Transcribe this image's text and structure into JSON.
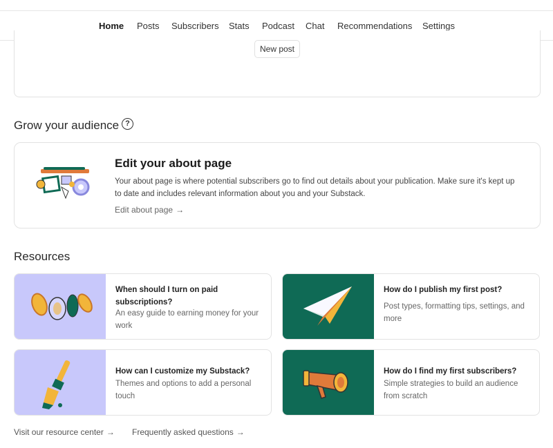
{
  "nav": {
    "tabs": [
      {
        "label": "Home",
        "active": true
      },
      {
        "label": "Posts"
      },
      {
        "label": "Subscribers"
      },
      {
        "label": "Stats"
      },
      {
        "label": "Podcast"
      },
      {
        "label": "Chat"
      },
      {
        "label": "Recommendations"
      },
      {
        "label": "Settings"
      }
    ]
  },
  "top_card": {
    "new_post_label": "New post"
  },
  "grow": {
    "title": "Grow your audience",
    "help_icon": "question-circle-icon",
    "about_card": {
      "title": "Edit your about page",
      "description": "Your about page is where potential subscribers go to find out details about your publication. Make sure it's kept up to date and includes relevant information about you and your Substack.",
      "link_label": "Edit about page"
    }
  },
  "resources": {
    "title": "Resources",
    "cards": [
      {
        "title": "When should I turn on paid subscriptions?",
        "description": "An easy guide to earning money for your work",
        "thumb_color": "#c8c8fb",
        "icon": "coins-icon"
      },
      {
        "title": "How do I publish my first post?",
        "description": "Post types, formatting tips, settings, and more",
        "thumb_color": "#0f6a55",
        "icon": "paper-plane-icon"
      },
      {
        "title": "How can I customize my Substack?",
        "description": "Themes and options to add a personal touch",
        "thumb_color": "#c8c8fb",
        "icon": "paintbrush-icon"
      },
      {
        "title": "How do I find my first subscribers?",
        "description": "Simple strategies to build an audience from scratch",
        "thumb_color": "#0f6a55",
        "icon": "megaphone-icon"
      }
    ]
  },
  "footer": {
    "resource_center_label": "Visit our resource center",
    "faq_label": "Frequently asked questions"
  }
}
